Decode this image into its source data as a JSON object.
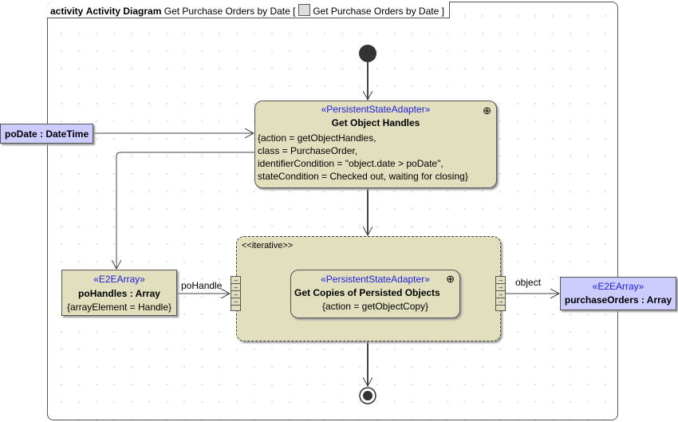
{
  "frame": {
    "kind": "activity",
    "type": "Activity Diagram",
    "name": "Get Purchase Orders by Date",
    "ref": "Get Purchase Orders by Date",
    "ref_icon": "diagram-icon"
  },
  "nodes": {
    "get_handles": {
      "stereotype": "«PersistentStateAdapter»",
      "name": "Get Object Handles",
      "props": [
        "{action = getObjectHandles,",
        "class = PurchaseOrder,",
        "identifierCondition = \"object.date > poDate\",",
        "stateCondition = Checked out, waiting for closing}"
      ]
    },
    "po_date": {
      "name": "poDate : DateTime"
    },
    "po_handles": {
      "stereotype": "«E2EArray»",
      "name": "poHandles : Array",
      "props": "{arrayElement = Handle}"
    },
    "region": {
      "stereotype": "<<iterative>>"
    },
    "get_copies": {
      "stereotype": "«PersistentStateAdapter»",
      "name": "Get Copies of Persisted Objects",
      "props": "{action = getObjectCopy}"
    },
    "purchase_orders": {
      "stereotype": "«E2EArray»",
      "name": "purchaseOrders : Array"
    }
  },
  "edges": {
    "po_handle_label": "poHandle",
    "object_label": "object"
  },
  "colors": {
    "action_fill": "#e1dfbd",
    "object_blue": "#ccccff",
    "stereotype": "#2020e0"
  }
}
